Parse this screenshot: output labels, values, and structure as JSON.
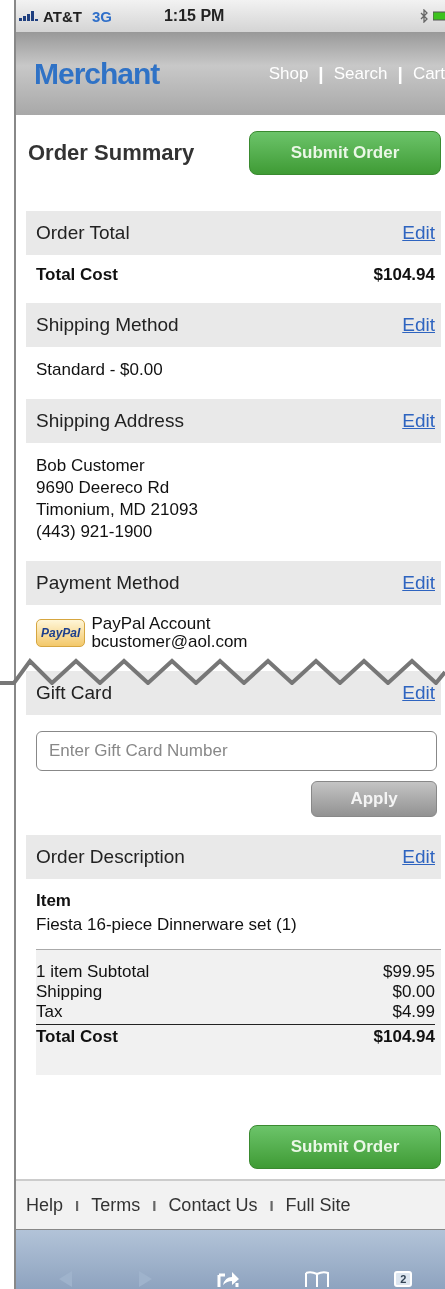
{
  "status_bar": {
    "carrier": "AT&T",
    "network": "3G",
    "time": "1:15 PM"
  },
  "header": {
    "logo": "Merchant",
    "nav": [
      {
        "kind": "link",
        "label": "Shop"
      },
      {
        "kind": "separator",
        "label": "|"
      },
      {
        "kind": "link",
        "label": "Search"
      },
      {
        "kind": "separator",
        "label": "|"
      },
      {
        "kind": "link",
        "label": "Cart"
      }
    ]
  },
  "page": {
    "title": "Order Summary",
    "submit": "Submit Order"
  },
  "sections": [
    {
      "kind": "totals",
      "title": "Order Total",
      "edit": "Edit",
      "rows": [
        {
          "label": "Total Cost",
          "value": "$104.94"
        }
      ]
    },
    {
      "kind": "lines",
      "title": "Shipping Method",
      "edit": "Edit",
      "lines": [
        "Standard - $0.00"
      ]
    },
    {
      "kind": "lines",
      "title": "Shipping Address",
      "edit": "Edit",
      "lines": [
        "Bob Customer",
        "9690 Deereco Rd",
        "Timonium, MD 21093",
        "(443) 921-1900"
      ]
    },
    {
      "kind": "payment",
      "title": "Payment Method",
      "edit": "Edit",
      "badge": "PayPal",
      "lines": [
        "PayPal Account",
        "bcustomer@aol.com"
      ]
    },
    {
      "kind": "giftcard",
      "title": "Gift Card",
      "edit": "Edit",
      "placeholder": "Enter Gift Card Number",
      "button": "Apply",
      "torn_above": true
    },
    {
      "kind": "description",
      "title": "Order Description",
      "edit": "Edit",
      "item_heading": "Item",
      "item": "Fiesta 16-piece Dinnerware set (1)",
      "rows": [
        {
          "label": "1 item Subtotal",
          "value": "$99.95",
          "total": false
        },
        {
          "label": "Shipping",
          "value": "$0.00",
          "total": false
        },
        {
          "label": "Tax",
          "value": "$4.99",
          "total": false
        },
        {
          "label": "Total Cost",
          "value": "$104.94",
          "total": true
        }
      ]
    }
  ],
  "bottom_submit": "Submit Order",
  "footer": [
    {
      "kind": "link",
      "label": "Help"
    },
    {
      "kind": "separator",
      "label": "I"
    },
    {
      "kind": "link",
      "label": "Terms"
    },
    {
      "kind": "separator",
      "label": "I"
    },
    {
      "kind": "link",
      "label": "Contact Us"
    },
    {
      "kind": "separator",
      "label": "I"
    },
    {
      "kind": "link",
      "label": "Full Site"
    }
  ],
  "browser_toolbar": {
    "tab_count": "2"
  }
}
